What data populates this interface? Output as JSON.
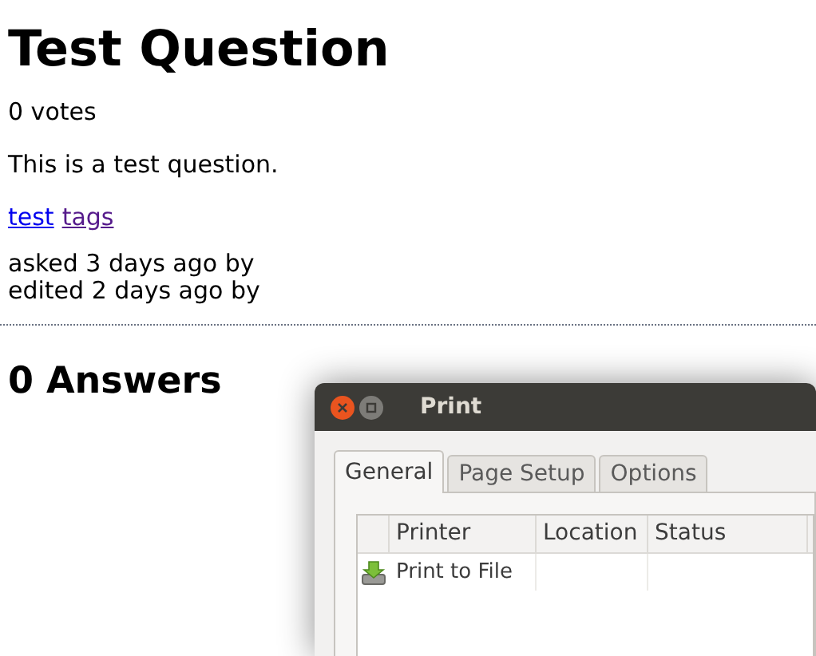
{
  "question": {
    "title": "Test Question",
    "votes": "0 votes",
    "body": "This is a test question.",
    "tags": [
      {
        "label": "test",
        "visited": false
      },
      {
        "label": "tags",
        "visited": true
      }
    ],
    "asked": "asked 3 days ago by",
    "edited": "edited 2 days ago by"
  },
  "answers_heading": "0 Answers",
  "print_dialog": {
    "title": "Print",
    "tabs": [
      {
        "label": "General",
        "selected": true
      },
      {
        "label": "Page Setup",
        "selected": false
      },
      {
        "label": "Options",
        "selected": false
      }
    ],
    "columns": [
      "Printer",
      "Location",
      "Status"
    ],
    "rows": [
      {
        "printer": "Print to File"
      }
    ]
  }
}
